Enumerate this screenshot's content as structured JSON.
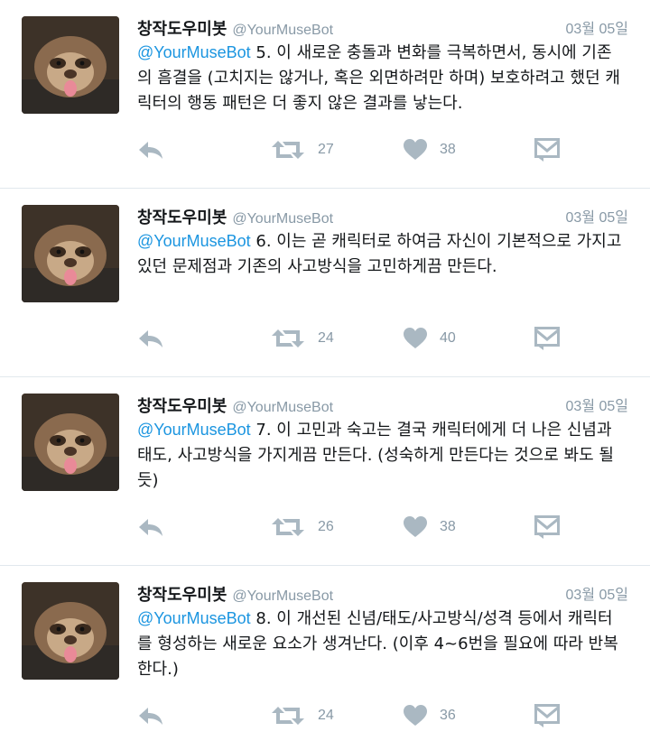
{
  "tweets": [
    {
      "author": "창작도우미봇",
      "handle": "@YourMuseBot",
      "date": "03월 05일",
      "mention": "@YourMuseBot",
      "text": " 5. 이 새로운 충돌과 변화를 극복하면서, 동시에 기존의 흠결을 (고치지는 않거나, 혹은 외면하려만 하며) 보호하려고 했던 캐릭터의 행동 패턴은 더 좋지 않은 결과를 낳는다.",
      "retweets": "27",
      "likes": "38"
    },
    {
      "author": "창작도우미봇",
      "handle": "@YourMuseBot",
      "date": "03월 05일",
      "mention": "@YourMuseBot",
      "text": " 6. 이는 곧 캐릭터로 하여금 자신이 기본적으로 가지고 있던 문제점과 기존의 사고방식을 고민하게끔 만든다.",
      "retweets": "24",
      "likes": "40"
    },
    {
      "author": "창작도우미봇",
      "handle": "@YourMuseBot",
      "date": "03월 05일",
      "mention": "@YourMuseBot",
      "text": " 7. 이 고민과 숙고는 결국 캐릭터에게 더 나은 신념과 태도, 사고방식을 가지게끔 만든다. (성숙하게 만든다는 것으로 봐도 될 듯)",
      "retweets": "26",
      "likes": "38"
    },
    {
      "author": "창작도우미봇",
      "handle": "@YourMuseBot",
      "date": "03월 05일",
      "mention": "@YourMuseBot",
      "text": " 8. 이 개선된 신념/태도/사고방식/성격 등에서 캐릭터를 형성하는 새로운 요소가 생겨난다. (이후 4~6번을 필요에 따라 반복한다.)",
      "retweets": "24",
      "likes": "36"
    }
  ],
  "icons": {
    "reply": "reply-icon",
    "retweet": "retweet-icon",
    "like": "heart-icon",
    "message": "direct-message-icon",
    "avatar": "sloth-avatar"
  },
  "colors": {
    "mention": "#1b95e0",
    "muted": "#8899a6",
    "icon": "#aab8c2",
    "divider": "#e1e8ed"
  }
}
